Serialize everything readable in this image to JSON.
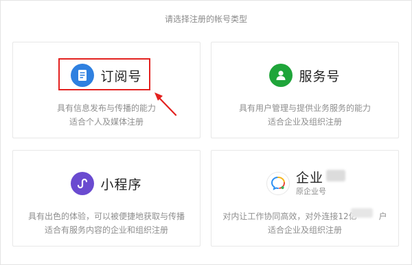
{
  "page": {
    "heading": "请选择注册的帐号类型"
  },
  "cards": {
    "subscription": {
      "title": "订阅号",
      "desc_line1": "具有信息发布与传播的能力",
      "desc_line2": "适合个人及媒体注册",
      "icon": "document-icon",
      "color": "#2f80e0"
    },
    "service": {
      "title": "服务号",
      "desc_line1": "具有用户管理与提供业务服务的能力",
      "desc_line2": "适合企业及组织注册",
      "icon": "user-icon",
      "color": "#1fa53a"
    },
    "miniprogram": {
      "title": "小程序",
      "desc_line1": "具有出色的体验，可以被便捷地获取与传播",
      "desc_line2": "适合有服务内容的企业和组织注册",
      "icon": "miniprogram-icon",
      "color": "#6a4bd0"
    },
    "enterprise": {
      "title": "企业",
      "subtitle": "原企业号",
      "desc_line1": "对内让工作协同高效，对外连接12亿",
      "desc_line1_tail": "户",
      "desc_line2": "适合企业及组织注册",
      "icon": "work-chat-icon"
    }
  },
  "annotation": {
    "highlight_color": "#e3211f"
  }
}
